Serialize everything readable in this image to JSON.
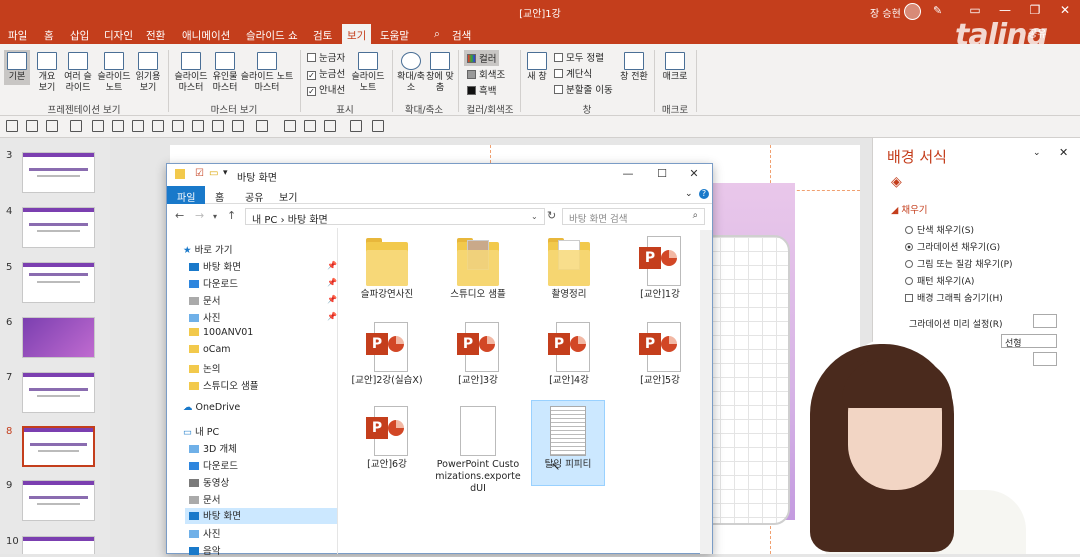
{
  "app": {
    "title": "[교안]1강",
    "user": "장 승현",
    "share": "공유",
    "logo": "taling"
  },
  "menu": [
    "파일",
    "홈",
    "삽입",
    "디자인",
    "전환",
    "애니메이션",
    "슬라이드 쇼",
    "검토",
    "보기",
    "도움말",
    "검색"
  ],
  "menu_selected": "보기",
  "ribbon": {
    "presentation_views": [
      "기본",
      "개요 보기",
      "여러 슬라이드",
      "슬라이드 노트",
      "읽기용 보기"
    ],
    "presentation_label": "프레젠테이션 보기",
    "master_views": [
      "슬라이드 마스터",
      "유인물 마스터",
      "슬라이드 노트 마스터"
    ],
    "master_label": "마스터 보기",
    "show": [
      "눈금자",
      "눈금선",
      "안내선"
    ],
    "show_checked": [
      false,
      true,
      true
    ],
    "notes": "슬라이드 노트",
    "show_label": "표시",
    "zoom": [
      "확대/축소",
      "창에 맞춤"
    ],
    "zoom_label": "확대/축소",
    "color": [
      "컬러",
      "회색조",
      "흑백"
    ],
    "color_label": "컬러/회색조",
    "window": [
      "새 창",
      "모두 정렬",
      "계단식",
      "분할줄 이동",
      "창 전환"
    ],
    "window_label": "창",
    "macro": "매크로",
    "macro_label": "매크로"
  },
  "thumbs": [
    "3",
    "4",
    "5",
    "6",
    "7",
    "8",
    "9",
    "10"
  ],
  "explorer": {
    "title": "바탕 화면",
    "tabs": [
      "파일",
      "홈",
      "공유",
      "보기"
    ],
    "address": "내 PC  ›  바탕 화면",
    "search_placeholder": "바탕 화면 검색",
    "sidebar": [
      {
        "label": "바로 가기"
      },
      {
        "label": "바탕 화면"
      },
      {
        "label": "다운로드"
      },
      {
        "label": "문서"
      },
      {
        "label": "사진"
      },
      {
        "label": "100ANV01"
      },
      {
        "label": "oCam"
      },
      {
        "label": "논의"
      },
      {
        "label": "스튜디오 샘플"
      },
      {
        "label": "OneDrive"
      },
      {
        "label": "내 PC"
      },
      {
        "label": "3D 개체"
      },
      {
        "label": "다운로드"
      },
      {
        "label": "동영상"
      },
      {
        "label": "문서"
      },
      {
        "label": "바탕 화면"
      },
      {
        "label": "사진"
      },
      {
        "label": "음악"
      }
    ],
    "items": [
      "슬파강연사진",
      "스튜디오 샘플",
      "촬영정리",
      "[교안]1강",
      "[교안]2강(실습X)",
      "[교안]3강",
      "[교안]4강",
      "[교안]5강",
      "[교안]6강",
      "PowerPoint Customizations.exportedUI",
      "탈잉 피피티"
    ]
  },
  "format_pane": {
    "title": "배경 서식",
    "section": "채우기",
    "options": [
      "단색 채우기(S)",
      "그라데이션 채우기(G)",
      "그림 또는 질감 채우기(P)",
      "패턴 채우기(A)",
      "배경 그래픽 숨기기(H)"
    ],
    "selected": "그라데이션 채우기(G)",
    "preset_label": "그라데이션 미리 설정(R)",
    "type_value": "선형"
  },
  "colors": {
    "accent": "#c43e1c",
    "explorer_blue": "#1979ca"
  }
}
